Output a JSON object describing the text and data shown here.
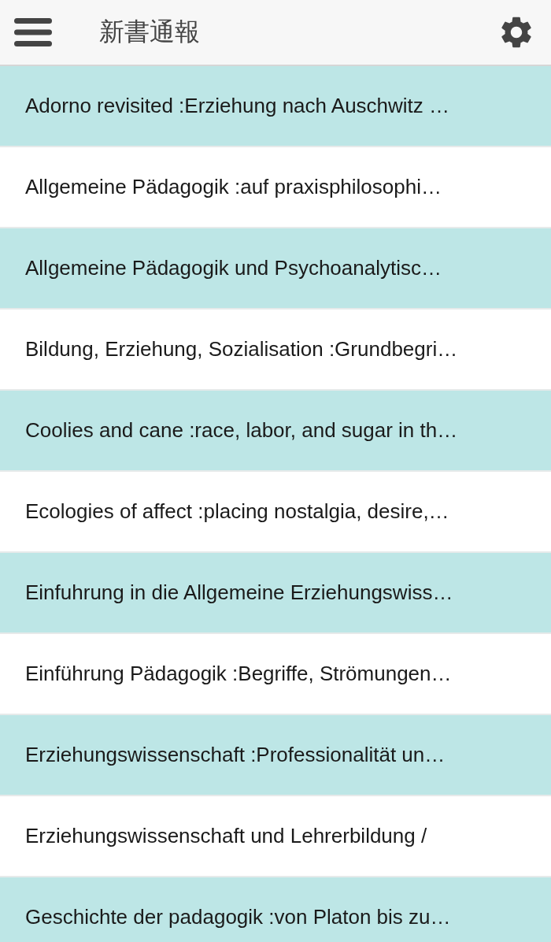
{
  "app_bar": {
    "title": "新書通報"
  },
  "books": [
    {
      "title": "Adorno revisited :Erziehung nach Auschwitz …"
    },
    {
      "title": "Allgemeine Pädagogik :auf praxisphilosophi…"
    },
    {
      "title": "Allgemeine Pädagogik und Psychoanalytisc…"
    },
    {
      "title": "Bildung, Erziehung, Sozialisation :Grundbegri…"
    },
    {
      "title": "Coolies and cane :race, labor, and sugar in th…"
    },
    {
      "title": "Ecologies of affect :placing nostalgia, desire,…"
    },
    {
      "title": "Einfuhrung in die Allgemeine Erziehungswiss…"
    },
    {
      "title": "Einführung Pädagogik :Begriffe, Strömungen…"
    },
    {
      "title": "Erziehungswissenschaft :Professionalität un…"
    },
    {
      "title": "Erziehungswissenschaft und Lehrerbildung /"
    },
    {
      "title": "Geschichte der padagogik :von Platon bis zu…"
    }
  ]
}
